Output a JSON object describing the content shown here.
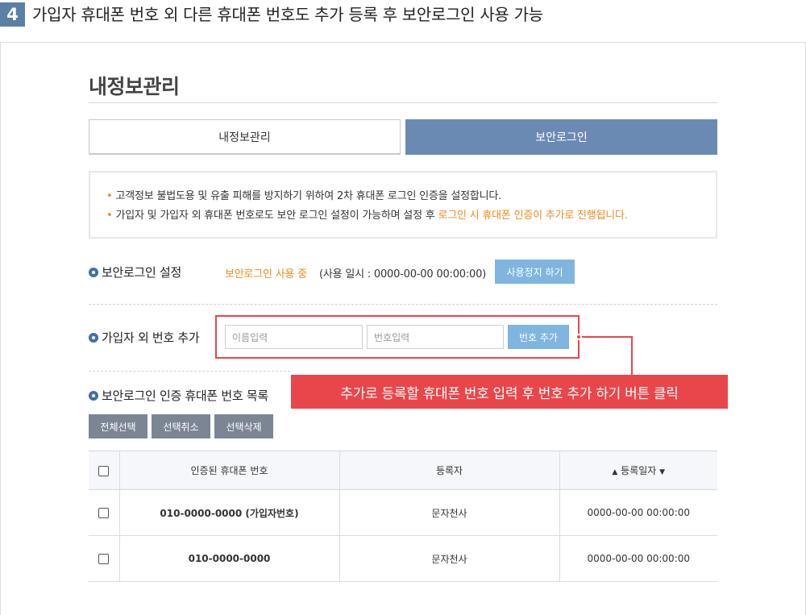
{
  "step": {
    "number": "4",
    "title": "가입자 휴대폰 번호 외 다른 휴대폰 번호도 추가 등록 후 보안로그인 사용 가능"
  },
  "page": {
    "title": "내정보관리"
  },
  "tabs": [
    {
      "label": "내정보관리",
      "active": false
    },
    {
      "label": "보안로그인",
      "active": true
    }
  ],
  "notice": {
    "line1": "고객정보 불법도용 및 유출 피해를 방지하기 위하여 2차 휴대폰 로그인 인증을 설정합니다.",
    "line2_prefix": "가입자 및 가입자 외 휴대폰 번호로도 보안 로그인 설정이 가능하며 설정 후 ",
    "line2_highlight": "로그인 시 휴대폰 인증이 추가로 진행됩니다.",
    "bullet": "•"
  },
  "secure_login": {
    "label": "보안로그인 설정",
    "status": "보안로그인 사용 중",
    "since": "(사용 일시 : 0000-00-00 00:00:00)",
    "stop_button": "사용정지 하기"
  },
  "add_number": {
    "label": "가입자 외 번호 추가",
    "name_placeholder": "이름입력",
    "phone_placeholder": "번호입력",
    "add_button": "번호 추가"
  },
  "callout": {
    "text": "추가로 등록할 휴대폰 번호 입력 후 번호 추가 하기 버튼 클릭"
  },
  "phone_list": {
    "label": "보안로그인 인증 휴대폰 번호 목록",
    "buttons": {
      "select_all": "전체선택",
      "deselect": "선택취소",
      "delete": "선택삭제"
    },
    "headers": {
      "phone": "인증된 휴대폰 번호",
      "registrant": "등록자",
      "date": "등록일자",
      "sort_up": "▲",
      "sort_down": "▼"
    },
    "rows": [
      {
        "phone": "010-0000-0000 (가입자번호)",
        "registrant": "문자천사",
        "date": "0000-00-00 00:00:00",
        "primary": true
      },
      {
        "phone": "010-0000-0000",
        "registrant": "문자천사",
        "date": "0000-00-00 00:00:00",
        "primary": false
      }
    ]
  },
  "colors": {
    "accent_blue": "#6a8ab3",
    "button_blue": "#7fb5e0",
    "orange": "#f08a1c",
    "callout_red": "#e8464a",
    "gray_button": "#7c8594"
  }
}
